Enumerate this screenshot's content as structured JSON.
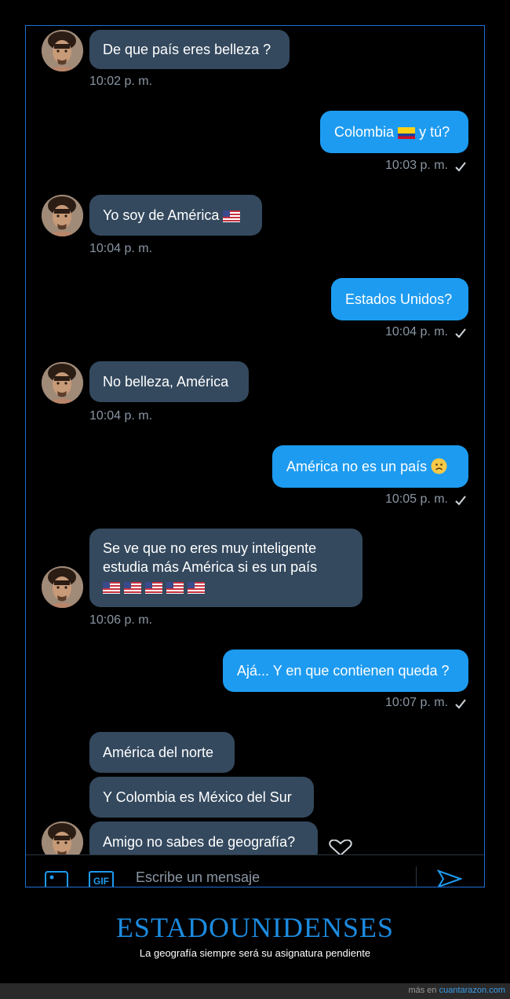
{
  "messages": [
    {
      "side": "in",
      "text": "De que país eres belleza ?",
      "time": "10:02 p. m."
    },
    {
      "side": "out",
      "text": "Colombia",
      "text2": "y tú?",
      "flag": "colombia-flag",
      "time": "10:03 p. m."
    },
    {
      "side": "in",
      "text": "Yo soy de América",
      "flag": "us-flag",
      "time": "10:04 p. m."
    },
    {
      "side": "out",
      "text": "Estados Unidos?",
      "time": "10:04 p. m."
    },
    {
      "side": "in",
      "text": "No belleza, América",
      "time": "10:04 p. m."
    },
    {
      "side": "out",
      "text": "América no es un país",
      "emoji": "frowning-face",
      "time": "10:05 p. m."
    },
    {
      "side": "in",
      "line1": "Se ve que no eres muy inteligente",
      "line2": "estudia más América si es un país",
      "flags": "us-flag x5",
      "time": "10:06 p. m."
    },
    {
      "side": "out",
      "text": "Ajá... Y en que contienen queda ?",
      "time": "10:07 p. m."
    },
    {
      "side": "in",
      "text": "América del norte"
    },
    {
      "side": "in",
      "text": "Y Colombia es México del Sur"
    },
    {
      "side": "in",
      "text": "Amigo no sabes de geografía?"
    }
  ],
  "composer": {
    "placeholder": "Escribe un mensaje",
    "gif_label": "GIF"
  },
  "caption": {
    "title": "ESTADOUNIDENSES",
    "subtitle": "La geografía siempre será su asignatura pendiente"
  },
  "footer": {
    "prefix": "más en",
    "site": "cuantarazon.com"
  },
  "colors": {
    "incoming_bubble": "#34495e",
    "outgoing_bubble": "#1d9bf0",
    "accent": "#1d8be0"
  }
}
